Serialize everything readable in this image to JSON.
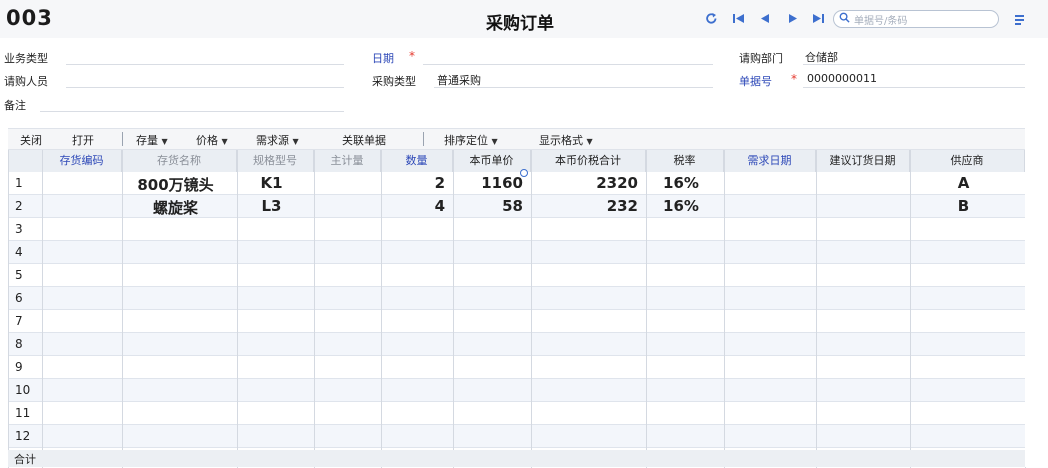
{
  "header": {
    "doc_code": "003",
    "title": "采购订单",
    "search_placeholder": "单据号/条码"
  },
  "form": {
    "business_type_label": "业务类型",
    "requester_label": "请购人员",
    "remark_label": "备注",
    "date_label": "日期",
    "purchase_type_label": "采购类型",
    "purchase_type_value": "普通采购",
    "dept_label": "请购部门",
    "dept_value": "仓储部",
    "doc_no_label": "单据号",
    "doc_no_value": "0000000011",
    "required_mark": "*"
  },
  "toolbar": {
    "close": "关闭",
    "open": "打开",
    "stock": "存量",
    "price": "价格",
    "demand_source": "需求源",
    "link_doc": "关联单据",
    "sort_locate": "排序定位",
    "display_format": "显示格式"
  },
  "table": {
    "columns": [
      "存货编码",
      "存货名称",
      "规格型号",
      "主计量",
      "数量",
      "本币单价",
      "本币价税合计",
      "税率",
      "需求日期",
      "建议订货日期",
      "供应商"
    ],
    "row_numbers": [
      "1",
      "2",
      "3",
      "4",
      "5",
      "6",
      "7",
      "8",
      "9",
      "10",
      "11",
      "12"
    ],
    "rows": [
      {
        "code": "",
        "name": "800万镜头",
        "spec": "K1",
        "unit": "",
        "qty": "2",
        "unit_price": "1160",
        "total": "2320",
        "tax_rate": "16%",
        "need_date": "",
        "suggest_date": "",
        "supplier": "A"
      },
      {
        "code": "",
        "name": "螺旋桨",
        "spec": "L3",
        "unit": "",
        "qty": "4",
        "unit_price": "58",
        "total": "232",
        "tax_rate": "16%",
        "need_date": "",
        "suggest_date": "",
        "supplier": "B"
      }
    ],
    "total_label": "合计"
  },
  "colors": {
    "accent": "#3d6fce",
    "required_label": "#2e49b8",
    "required_star": "#e53a2f",
    "header_bg": "#eaeef3",
    "alt_row": "#f3f6fb"
  }
}
